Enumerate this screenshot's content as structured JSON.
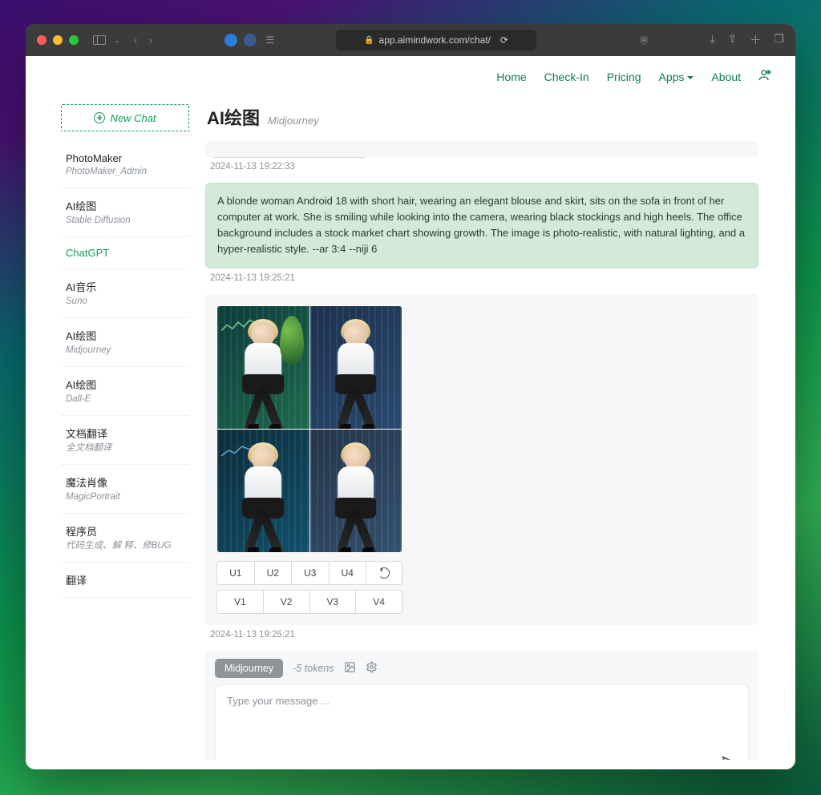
{
  "browser": {
    "url": "app.aimindwork.com/chat/"
  },
  "nav": {
    "items": [
      "Home",
      "Check-In",
      "Pricing",
      "Apps",
      "About"
    ]
  },
  "sidebar": {
    "new_chat": "New Chat",
    "items": [
      {
        "title": "PhotoMaker",
        "sub": "PhotoMaker_Admin"
      },
      {
        "title": "AI绘图",
        "sub": "Stable\nDiffusion"
      },
      {
        "title": "ChatGPT",
        "sub": ""
      },
      {
        "title": "AI音乐",
        "sub": "Suno"
      },
      {
        "title": "AI绘图",
        "sub": "Midjourney"
      },
      {
        "title": "AI绘图",
        "sub": "Dall-E"
      },
      {
        "title": "文档翻译",
        "sub": "全文档翻译"
      },
      {
        "title": "魔法肖像",
        "sub": "MagicPortrait"
      },
      {
        "title": "程序员",
        "sub": "代码生成、解\n释、修BUG"
      },
      {
        "title": "翻译",
        "sub": ""
      }
    ],
    "active_index": 2
  },
  "heading": {
    "title": "AI绘图",
    "subtitle": "Midjourney"
  },
  "timestamps": {
    "t0": "2024-11-13 19:22:33",
    "t1": "2024-11-13 19:25:21",
    "t2": "2024-11-13 19:25:21"
  },
  "prompt_text": "A blonde woman Android 18 with short hair, wearing an elegant blouse and skirt, sits on the sofa in front of her computer at work. She is smiling while looking into the camera, wearing black stockings and high heels. The office background includes a stock market chart showing growth. The image is photo-realistic, with natural lighting, and a hyper-realistic style. --ar 3:4 --niji 6",
  "upscale_buttons": [
    "U1",
    "U2",
    "U3",
    "U4"
  ],
  "variation_buttons": [
    "V1",
    "V2",
    "V3",
    "V4"
  ],
  "composer": {
    "model_pill": "Midjourney",
    "token_note": "-5 tokens",
    "placeholder": "Type your message ..."
  }
}
